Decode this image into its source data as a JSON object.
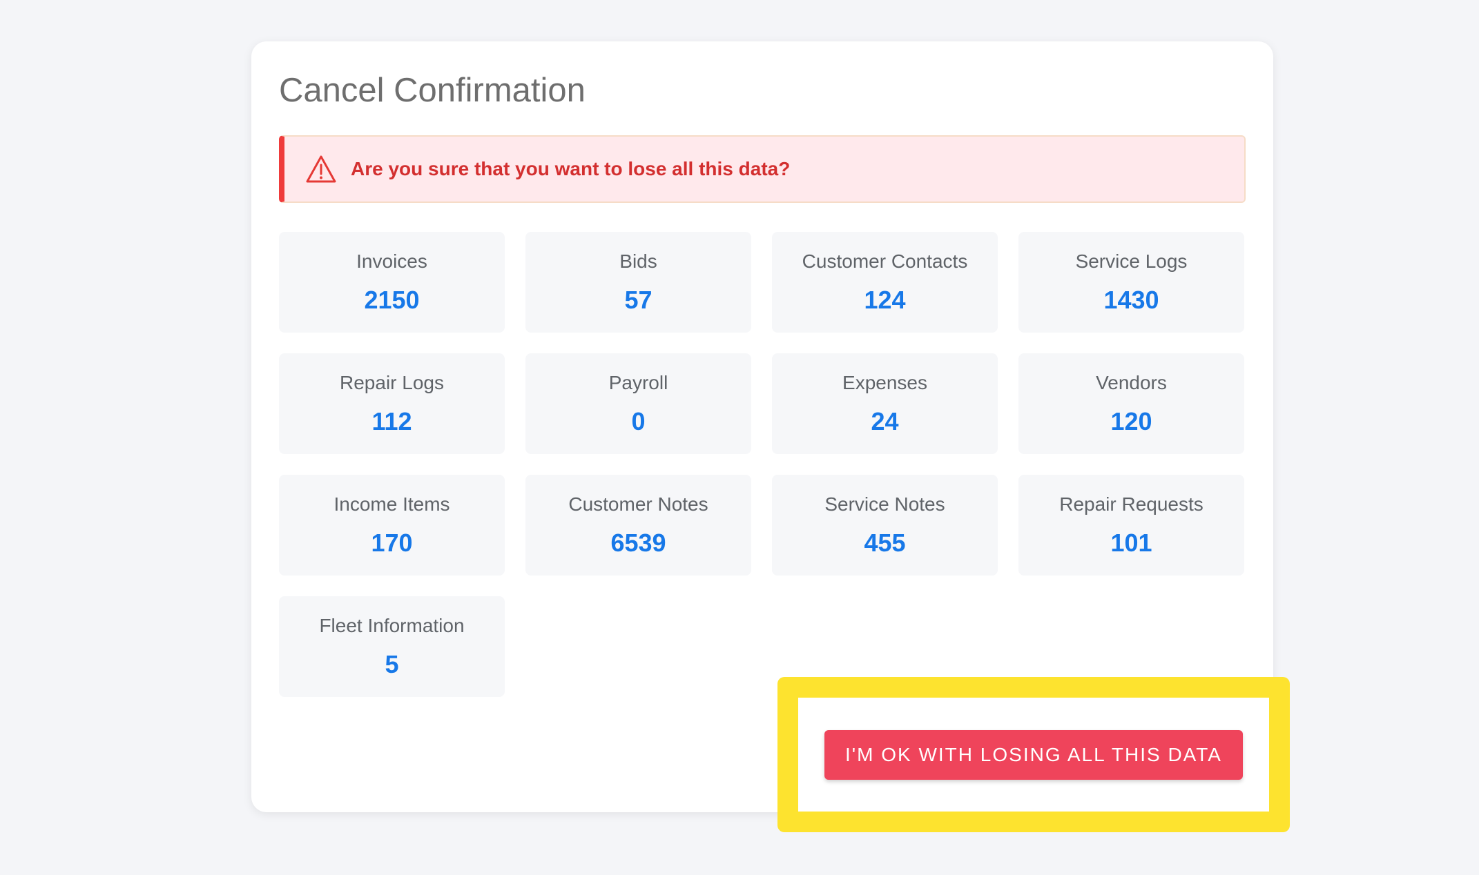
{
  "dialog": {
    "title": "Cancel Confirmation",
    "alert": {
      "message": "Are you sure that you want to lose all this data?",
      "icon": "warning-triangle-icon",
      "color": "#d32f2f"
    },
    "stats": [
      {
        "label": "Invoices",
        "value": "2150"
      },
      {
        "label": "Bids",
        "value": "57"
      },
      {
        "label": "Customer Contacts",
        "value": "124"
      },
      {
        "label": "Service Logs",
        "value": "1430"
      },
      {
        "label": "Repair Logs",
        "value": "112"
      },
      {
        "label": "Payroll",
        "value": "0"
      },
      {
        "label": "Expenses",
        "value": "24"
      },
      {
        "label": "Vendors",
        "value": "120"
      },
      {
        "label": "Income Items",
        "value": "170"
      },
      {
        "label": "Customer Notes",
        "value": "6539"
      },
      {
        "label": "Service Notes",
        "value": "455"
      },
      {
        "label": "Repair Requests",
        "value": "101"
      },
      {
        "label": "Fleet Information",
        "value": "5"
      }
    ],
    "confirm_button": {
      "label": "I'M OK WITH LOSING ALL THIS DATA",
      "color": "#ef445b"
    }
  },
  "highlight_color": "#fde32f"
}
